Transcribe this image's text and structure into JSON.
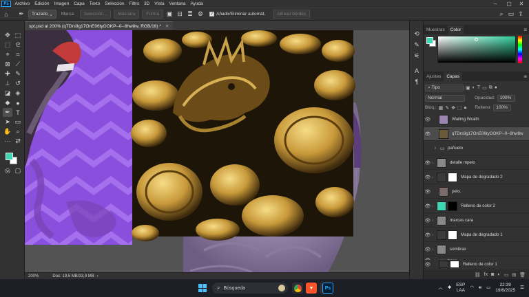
{
  "menubar": {
    "logo": "Ps",
    "items": [
      "Archivo",
      "Edición",
      "Imagen",
      "Capa",
      "Texto",
      "Selección",
      "Filtro",
      "3D",
      "Vista",
      "Ventana",
      "Ayuda"
    ]
  },
  "options": {
    "mode": "Trazado",
    "make_label": "Marca:",
    "btn_selection": "Selección...",
    "btn_mask": "Máscara",
    "btn_shape": "Forma",
    "auto_add_delete": "Añadir/Eliminar automát.",
    "align_edges": "Alinear bordes"
  },
  "document": {
    "tab_title": "spt.psd al 200% (qTDrs9g17OnE06tyOOKP--0--8hw8w, RGB/16) *",
    "zoom": "200%",
    "doc_size": "Doc: 19,5 MB/33,9 MB"
  },
  "color_panel": {
    "tab_swatches": "Muestras",
    "tab_color": "Color",
    "fg_color": "#3fd6b3",
    "bg_color": "#ffffff"
  },
  "layers_panel": {
    "tab_adjustments": "Ajustes",
    "tab_layers": "Capas",
    "filter_kind": "Tipo",
    "blend_mode": "Normal",
    "opacity_label": "Opacidad:",
    "opacity_value": "100%",
    "lock_label": "Bloq.:",
    "fill_label": "Relleno:",
    "fill_value": "100%",
    "layers": [
      {
        "name": "Wailing Wraith",
        "thumb": "#9a86b0"
      },
      {
        "name": "qTDrs9g17OnE06tyOOKP--0--8hw8w",
        "thumb": "#6a5a3a"
      },
      {
        "name": "pañuelo",
        "thumb": ""
      },
      {
        "name": "detalle mpelo",
        "thumb": "#888888"
      },
      {
        "name": "Mapa de degradado 2",
        "thumb": "#ffffff"
      },
      {
        "name": "pelo.",
        "thumb": "#7a6a6a"
      },
      {
        "name": "Relleno de color 2",
        "thumb": "#3fd6b3"
      },
      {
        "name": "marcas cara",
        "thumb": "#888888"
      },
      {
        "name": "Mapa de degradado 1",
        "thumb": "#ffffff"
      },
      {
        "name": "sombras",
        "thumb": "#888888"
      },
      {
        "name": "base",
        "thumb": ""
      },
      {
        "name": "Relleno de color 1",
        "thumb": "#ffffff"
      }
    ]
  },
  "taskbar": {
    "search_placeholder": "Búsqueda",
    "lang_line1": "ESP",
    "lang_line2": "LAA",
    "time": "22:39",
    "date": "19/6/2025"
  }
}
